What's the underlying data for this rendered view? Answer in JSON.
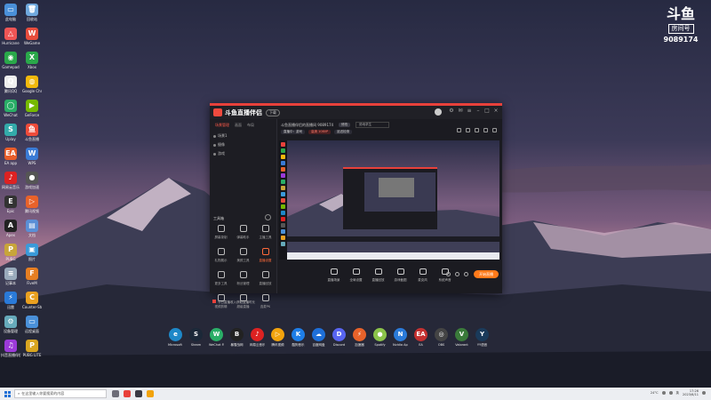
{
  "wallpaper": {
    "sky_top": "#2a2b44",
    "sky_mid": "#6a5576",
    "glow": "#d58a9a",
    "mountain": "#3a3a52",
    "snow": "#d9c8d8",
    "forest": "#1e2030"
  },
  "watermark": {
    "logo": "斗鱼",
    "tag": "房间号",
    "room_id": "9089174"
  },
  "desktop_icons": [
    {
      "label": "此电脑",
      "color": "#4a90d9",
      "glyph": "▭"
    },
    {
      "label": "回收站",
      "color": "#6fa8dc",
      "glyph": "🗑"
    },
    {
      "label": "Hurricane",
      "color": "#e55",
      "glyph": "△"
    },
    {
      "label": "WeGame",
      "color": "#e74c3c",
      "glyph": "W"
    },
    {
      "label": "Gamepad",
      "color": "#2aa84a",
      "glyph": "◉"
    },
    {
      "label": "Xbox",
      "color": "#2aa84a",
      "glyph": "X"
    },
    {
      "label": "腾讯QQ",
      "color": "#eee",
      "glyph": "Q"
    },
    {
      "label": "Google Chrome",
      "color": "#f2b90d",
      "glyph": "◍"
    },
    {
      "label": "WeChat",
      "color": "#2aae67",
      "glyph": "◯"
    },
    {
      "label": "GeForce",
      "color": "#76b900",
      "glyph": "▶"
    },
    {
      "label": "Uplay",
      "color": "#3aa",
      "glyph": "S"
    },
    {
      "label": "斗鱼直播",
      "color": "#ee4b3a",
      "glyph": "鱼"
    },
    {
      "label": "EA app",
      "color": "#e85d2a",
      "glyph": "EA"
    },
    {
      "label": "WPS",
      "color": "#3a7bd5",
      "glyph": "W"
    },
    {
      "label": "网易云音乐",
      "color": "#d22",
      "glyph": "♪"
    },
    {
      "label": "游戏加速",
      "color": "#555",
      "glyph": "●"
    },
    {
      "label": "Epic",
      "color": "#333",
      "glyph": "E"
    },
    {
      "label": "腾讯视频",
      "color": "#e8622a",
      "glyph": "▷"
    },
    {
      "label": "Apex",
      "color": "#222",
      "glyph": "A"
    },
    {
      "label": "文档",
      "color": "#5a8fd6",
      "glyph": "▤"
    },
    {
      "label": "PUBG",
      "color": "#c8a53a",
      "glyph": "P"
    },
    {
      "label": "照片",
      "color": "#3a9ad9",
      "glyph": "▣"
    },
    {
      "label": "记事本",
      "color": "#9ab",
      "glyph": "≡"
    },
    {
      "label": "FiveM",
      "color": "#e67e22",
      "glyph": "F"
    },
    {
      "label": "迅雷",
      "color": "#2a7ad9",
      "glyph": "⚡"
    },
    {
      "label": "Counter-Strike",
      "color": "#e9a020",
      "glyph": "C"
    },
    {
      "label": "设备管理",
      "color": "#6ab",
      "glyph": "⚙"
    },
    {
      "label": "远程桌面",
      "color": "#4a90d9",
      "glyph": "▭"
    },
    {
      "label": "抖音直播伴侣",
      "color": "#9b3ad9",
      "glyph": "♫"
    },
    {
      "label": "PUBG LITE",
      "color": "#d9a520",
      "glyph": "P"
    }
  ],
  "app": {
    "brand": "斗鱼直播伴侣",
    "badge": "下载",
    "left_tabs": [
      "场景管理",
      "画面",
      "布局"
    ],
    "scenes": [
      "场景1",
      "摄像",
      "游戏"
    ],
    "tools_title": "工具箱",
    "tools": [
      {
        "label": "屏幕录制"
      },
      {
        "label": "弹幕助手"
      },
      {
        "label": "主播工具"
      },
      {
        "label": "礼物展示"
      },
      {
        "label": "美颜工具"
      },
      {
        "label": "直播设置"
      },
      {
        "label": "更多工具"
      },
      {
        "label": "粉丝管理"
      },
      {
        "label": "直播回放"
      },
      {
        "label": "视频剪辑"
      },
      {
        "label": "超级直播"
      },
      {
        "label": "连麦PK"
      }
    ],
    "notice": "今日直播收入获取直播时长",
    "room_title": "斗鱼直播伴侣的直播间 9089174",
    "room_tag": "修改",
    "category": "绝地求生",
    "chips": [
      {
        "label": "直播中：游戏",
        "red": false
      },
      {
        "label": "高清 1080P",
        "red": true
      },
      {
        "label": "延迟检测",
        "red": false
      }
    ],
    "bottom_items": [
      {
        "label": "直播场景"
      },
      {
        "label": "全局设置"
      },
      {
        "label": "直播回放"
      },
      {
        "label": "游戏截图"
      },
      {
        "label": "麦克风"
      },
      {
        "label": "系统声音"
      }
    ],
    "live_button": "开始直播"
  },
  "dock": [
    {
      "label": "Microsoft Edge",
      "color": "#1e88c8",
      "glyph": "e"
    },
    {
      "label": "Steam",
      "color": "#1b2838",
      "glyph": "S"
    },
    {
      "label": "WeChat Files",
      "color": "#2aae67",
      "glyph": "W"
    },
    {
      "label": "暴雪战网",
      "color": "#222",
      "glyph": "B"
    },
    {
      "label": "网易云音乐",
      "color": "#d22",
      "glyph": "♪"
    },
    {
      "label": "腾讯视频",
      "color": "#f2a30d",
      "glyph": "▷"
    },
    {
      "label": "酷狗音乐",
      "color": "#1e7ee8",
      "glyph": "K"
    },
    {
      "label": "百度网盘",
      "color": "#1e6fd9",
      "glyph": "☁"
    },
    {
      "label": "Discord",
      "color": "#5865f2",
      "glyph": "D"
    },
    {
      "label": "加速器",
      "color": "#e8622a",
      "glyph": "⚡"
    },
    {
      "label": "Spotify",
      "color": "#8bc34a",
      "glyph": "●"
    },
    {
      "label": "Nvidia App",
      "color": "#2a7ad9",
      "glyph": "N"
    },
    {
      "label": "EA",
      "color": "#c43030",
      "glyph": "EA"
    },
    {
      "label": "OBS",
      "color": "#444",
      "glyph": "◎"
    },
    {
      "label": "Valorant",
      "color": "#3a7a3a",
      "glyph": "V"
    },
    {
      "label": "YY语音",
      "color": "#1a3a5a",
      "glyph": "Y"
    }
  ],
  "taskbar": {
    "search_placeholder": "在这里输入你要搜索的内容",
    "weather": "24°C",
    "time": "17:26",
    "date": "2023/6/11",
    "ime": "英"
  }
}
